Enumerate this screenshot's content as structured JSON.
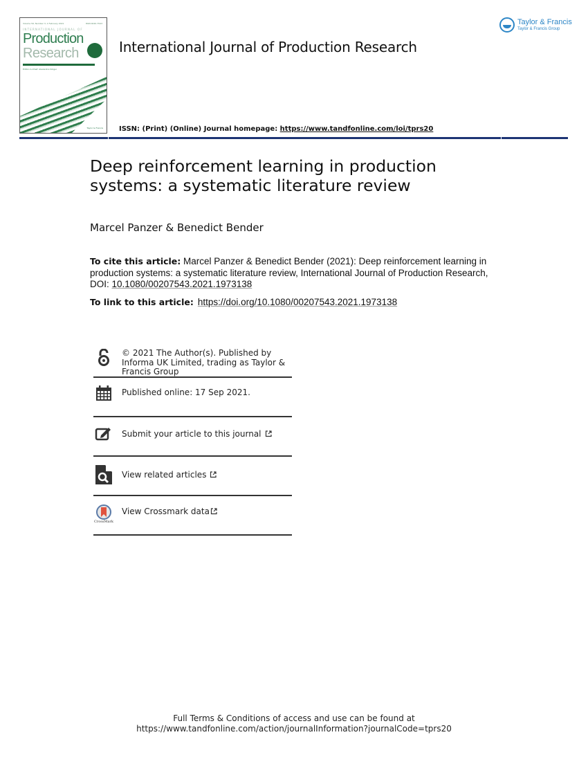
{
  "cover": {
    "volume_line": "Volume 59, Number 3, 1 February 2021",
    "issn": "ISSN 0020-7543",
    "series": "INTERNATIONAL JOURNAL OF",
    "title_line1": "Production",
    "title_line2": "Research",
    "badge": "Published since 1961",
    "editor": "Editor-in-Chief: Alexandre Dolgui",
    "publisher": "Taylor & Francis"
  },
  "header": {
    "journal_title": "International Journal of Production Research",
    "publisher_logo": {
      "name": "Taylor & Francis",
      "group": "Taylor & Francis Group",
      "color": "#2d86c6"
    },
    "issn_label": "ISSN: (Print) (Online) Journal homepage: ",
    "homepage_url": "https://www.tandfonline.com/loi/tprs20",
    "rule_color": "#1c3474"
  },
  "article": {
    "title": "Deep reinforcement learning in production systems: a systematic literature review",
    "authors": "Marcel Panzer & Benedict Bender"
  },
  "citation": {
    "label": "To cite this article:",
    "text": " Marcel Panzer & Benedict Bender (2021): Deep reinforcement learning in production systems: a systematic literature review, International Journal of Production Research, DOI: ",
    "doi": "10.1080/00207543.2021.1973138",
    "link_label": "To link to this article:",
    "link_url": "https://doi.org/10.1080/00207543.2021.1973138"
  },
  "info_items": [
    {
      "icon": "open-access-icon",
      "text": "© 2021 The Author(s). Published by Informa UK Limited, trading as Taylor & Francis Group"
    },
    {
      "icon": "calendar-icon",
      "text": "Published online: 17 Sep 2021."
    },
    {
      "icon": "edit-icon",
      "text": "Submit your article to this journal"
    },
    {
      "icon": "related-search-icon",
      "text": "View related articles"
    },
    {
      "icon": "crossmark-icon",
      "text": "View Crossmark data",
      "crossmark_label": "CrossMark"
    }
  ],
  "footer": {
    "line1": "Full Terms & Conditions of access and use can be found at",
    "line2": "https://www.tandfonline.com/action/journalInformation?journalCode=tprs20"
  }
}
